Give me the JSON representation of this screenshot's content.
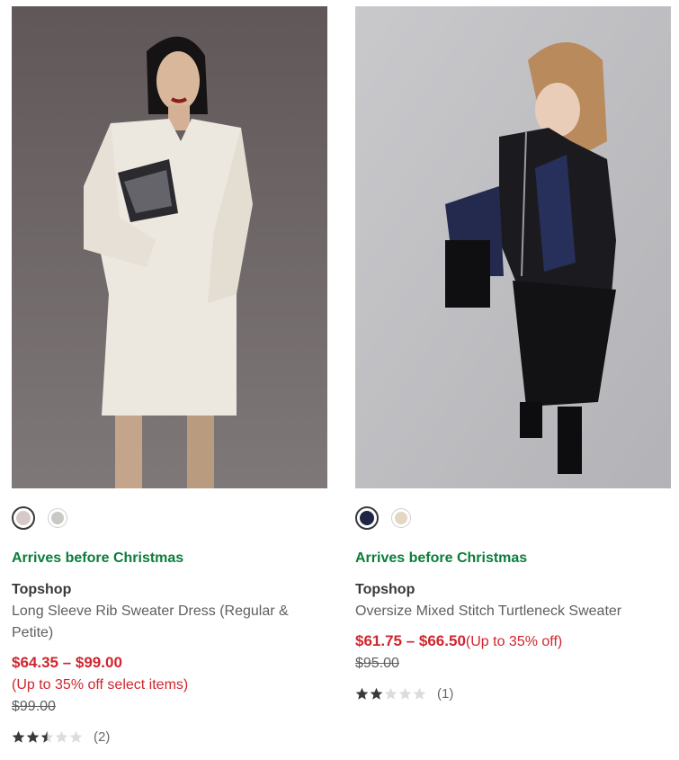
{
  "products": [
    {
      "image_icon": "product-photo-sweater-dress",
      "swatches": [
        {
          "color": "#d8c9c9",
          "selected": true
        },
        {
          "color": "#c9c9c4",
          "selected": false
        }
      ],
      "arrival": "Arrives before Christmas",
      "brand": "Topshop",
      "title": "Long Sleeve Rib Sweater Dress (Regular & Petite)",
      "price": "$64.35 – $99.00",
      "discount": "(Up to 35% off select items)",
      "original_price": "$99.00",
      "rating": 2.5,
      "review_count": "(2)"
    },
    {
      "image_icon": "product-photo-turtleneck-sweater",
      "swatches": [
        {
          "color": "#1f2545",
          "selected": true
        },
        {
          "color": "#e4d7c2",
          "selected": false
        }
      ],
      "arrival": "Arrives before Christmas",
      "brand": "Topshop",
      "title": "Oversize Mixed Stitch Turtleneck Sweater",
      "price": "$61.75 – $66.50",
      "discount": "(Up to 35% off)",
      "original_price": "$95.00",
      "rating": 2,
      "review_count": "(1)"
    }
  ],
  "colors": {
    "sale_red": "#d0262e",
    "arrival_green": "#0b7d3a",
    "star_filled": "#393939",
    "star_empty": "#dcdcdc"
  }
}
